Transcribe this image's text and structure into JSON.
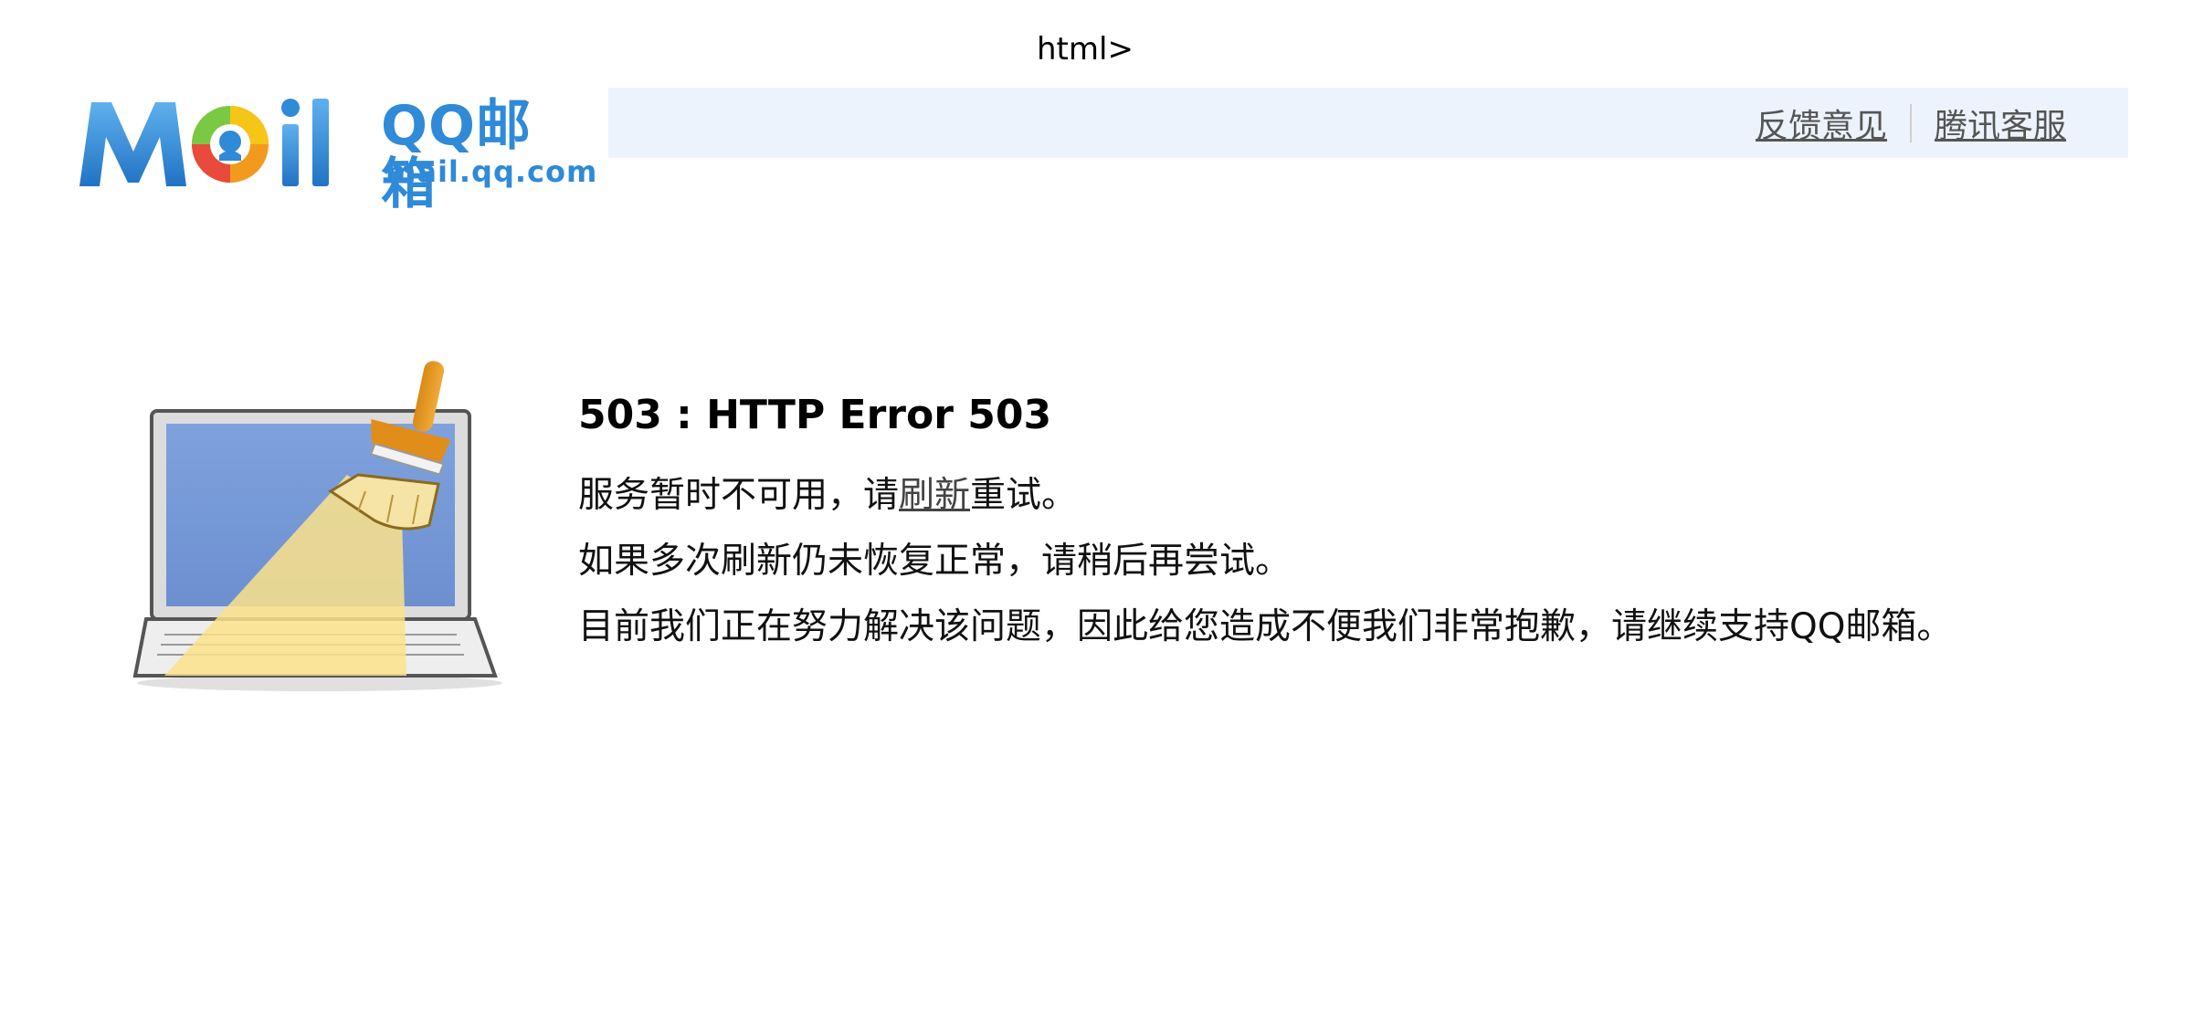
{
  "stray_text": "html>",
  "logo": {
    "mark_text": "Moil",
    "chinese": "QQ邮箱",
    "domain": "mail.qq.com"
  },
  "header": {
    "links": [
      "反馈意见",
      "腾讯客服"
    ]
  },
  "illustration": {
    "icon": "laptop-broom-icon"
  },
  "error": {
    "title": "503 : HTTP Error 503",
    "line1_before": "服务暂时不可用，请",
    "line1_link": "刷新",
    "line1_after": "重试。",
    "line2": "如果多次刷新仍未恢复正常，请稍后再尝试。",
    "line3": "目前我们正在努力解决该问题，因此给您造成不便我们非常抱歉，请继续支持QQ邮箱。"
  },
  "colors": {
    "brand_blue": "#2f8ad8",
    "header_bar": "#edf3fd"
  }
}
